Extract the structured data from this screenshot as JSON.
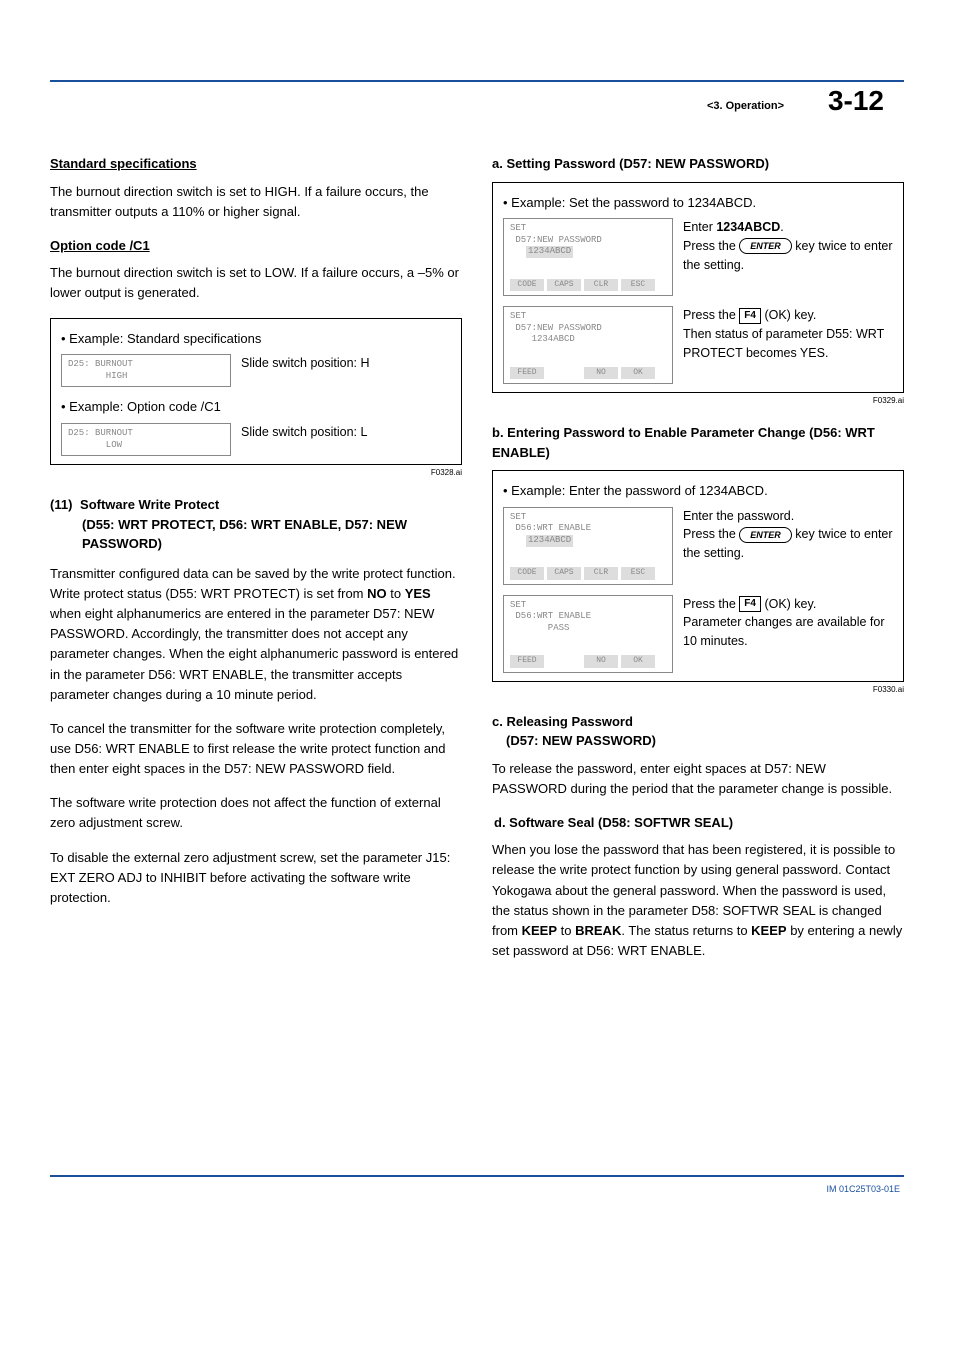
{
  "header": {
    "section": "<3.  Operation>",
    "page_number": "3-12"
  },
  "left": {
    "std_spec_heading": "Standard specifications",
    "std_spec_para": "The burnout direction switch is set to HIGH. If a failure occurs, the transmitter outputs a 110% or higher signal.",
    "opt_heading": "Option code /C1",
    "opt_para": "The burnout direction switch is set to LOW. If a failure occurs, a –5% or lower output is generated.",
    "ex1_title": "• Example: Standard specifications",
    "ex1_lcd_l1": "D25: BURNOUT",
    "ex1_lcd_l2": "       HIGH",
    "ex1_note": "Slide switch position: H",
    "ex2_title": "• Example: Option code /C1",
    "ex2_lcd_l1": "D25: BURNOUT",
    "ex2_lcd_l2": "       LOW",
    "ex2_note": "Slide switch position: L",
    "fig1_id": "F0328.ai",
    "s11_num": "(11)",
    "s11_line1": "Software Write Protect",
    "s11_line2": "(D55: WRT PROTECT, D56: WRT ENABLE, D57: NEW PASSWORD)",
    "s11_p1a": "Transmitter configured data can be saved by the write protect function. Write protect status (D55: WRT PROTECT) is set from ",
    "s11_p1_b1": "NO",
    "s11_p1_mid": " to ",
    "s11_p1_b2": "YES",
    "s11_p1b": " when eight alphanumerics are entered in the parameter D57: NEW PASSWORD. Accordingly, the transmitter does not accept any parameter changes. When the eight alphanumeric password is entered in the parameter D56: WRT ENABLE, the transmitter accepts parameter changes during a 10 minute period.",
    "s11_p2": "To cancel the transmitter for the software write protection completely, use D56: WRT ENABLE to first release the write protect function and then enter eight spaces in the D57: NEW PASSWORD field.",
    "s11_p3": "The software write protection does not affect the function of external zero adjustment screw.",
    "s11_p4": "To disable the external zero adjustment screw, set the parameter J15: EXT ZERO ADJ to INHIBIT before activating the software write protection."
  },
  "right": {
    "a_heading": "a. Setting Password (D57: NEW PASSWORD)",
    "a_title": "• Example: Set the password to 1234ABCD.",
    "a1_lcd_top": "SET",
    "a1_lcd_l1": " D57:NEW PASSWORD",
    "a1_lcd_val": "1234ABCD",
    "a1_btns": [
      "CODE",
      "CAPS",
      "CLR",
      "ESC"
    ],
    "a1_note_l1a": "Enter ",
    "a1_note_l1b": "1234ABCD",
    "a1_note_l1c": ".",
    "a1_note_l2a": "Press the ",
    "a1_note_l2key": "ENTER",
    "a1_note_l2b": " key twice to enter the setting.",
    "a2_lcd_top": "SET",
    "a2_lcd_l1": " D57:NEW PASSWORD",
    "a2_lcd_l2": "    1234ABCD",
    "a2_btns": [
      "FEED",
      "",
      "NO",
      "OK"
    ],
    "a2_note_l1a": "Press the ",
    "a2_note_l1key": "F4",
    "a2_note_l1b": " (OK) key.",
    "a2_note_l2": "Then status of parameter D55: WRT PROTECT becomes YES.",
    "fig2_id": "F0329.ai",
    "b_heading": "b. Entering Password to Enable Parameter Change (D56: WRT ENABLE)",
    "b_title": "• Example: Enter the password of 1234ABCD.",
    "b1_lcd_top": "SET",
    "b1_lcd_l1": " D56:WRT ENABLE",
    "b1_lcd_val": "1234ABCD",
    "b1_btns": [
      "CODE",
      "CAPS",
      "CLR",
      "ESC"
    ],
    "b1_note_l1": "Enter the password.",
    "b1_note_l2a": "Press the ",
    "b1_note_l2key": "ENTER",
    "b1_note_l2b": " key twice to enter the setting.",
    "b2_lcd_top": "SET",
    "b2_lcd_l1": " D56:WRT ENABLE",
    "b2_lcd_l2": "       PASS",
    "b2_btns": [
      "FEED",
      "",
      "NO",
      "OK"
    ],
    "b2_note_l1a": "Press the ",
    "b2_note_l1key": "F4",
    "b2_note_l1b": " (OK) key.",
    "b2_note_l2": "Parameter changes are available for 10 minutes.",
    "fig3_id": "F0330.ai",
    "c_heading_l1": "c. Releasing Password",
    "c_heading_l2": "(D57: NEW PASSWORD)",
    "c_para": "To release the password, enter eight spaces at D57: NEW PASSWORD during the period that the parameter change is possible.",
    "d_heading": "d. Software Seal (D58: SOFTWR SEAL)",
    "d_p_a": "When you lose the password that has been registered, it is possible to release the write protect function by using general password. Contact Yokogawa about the general password. When the password is used, the status shown in the parameter D58: SOFTWR SEAL is changed from ",
    "d_b1": "KEEP",
    "d_p_b": " to ",
    "d_b2": "BREAK",
    "d_p_c": ". The status returns to ",
    "d_b3": "KEEP",
    "d_p_d": " by entering a newly set password at D56: WRT ENABLE."
  },
  "footer": {
    "doc_id": "IM 01C25T03-01E"
  }
}
